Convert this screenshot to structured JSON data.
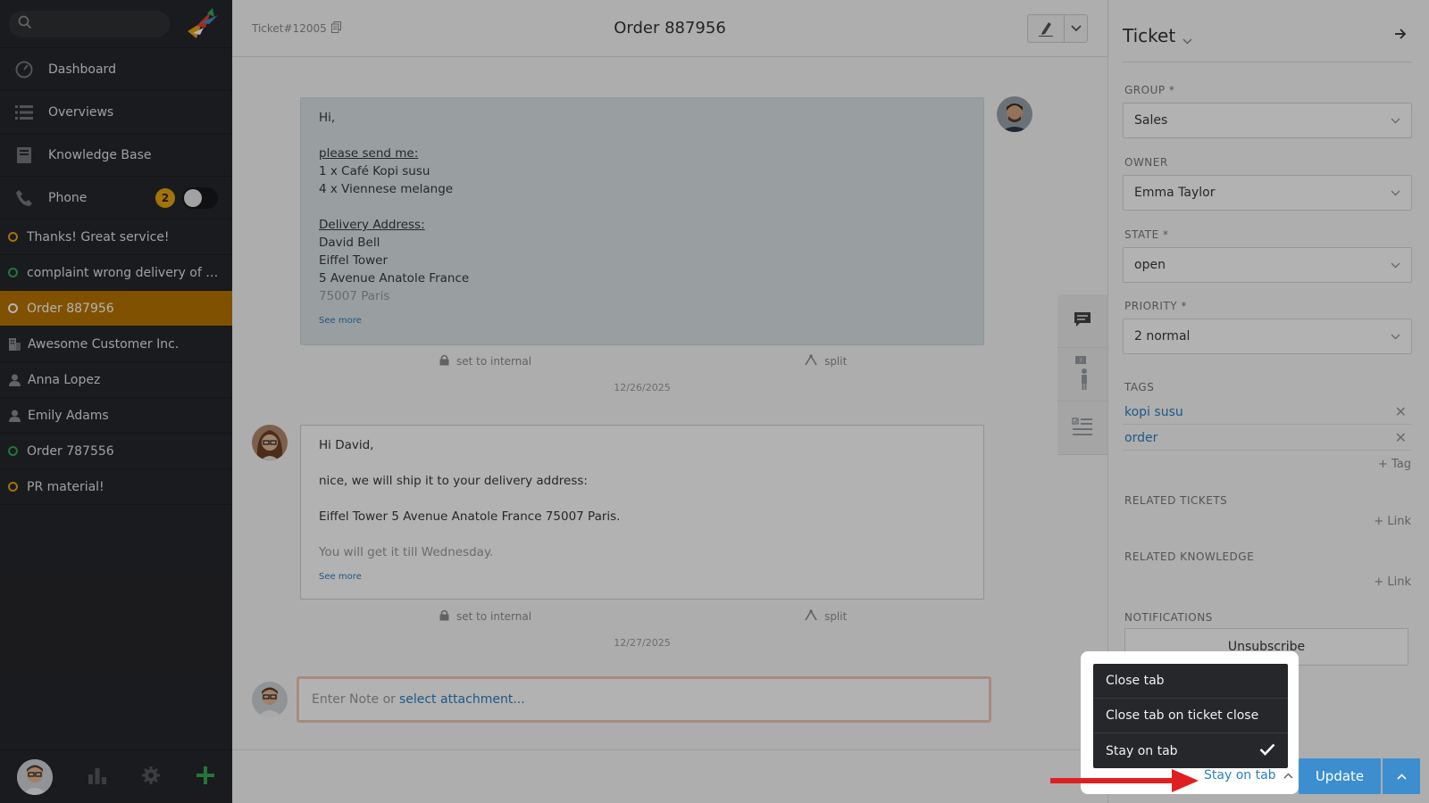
{
  "sidebar": {
    "search_placeholder": "",
    "nav": [
      {
        "label": "Dashboard",
        "icon": "dashboard-icon"
      },
      {
        "label": "Overviews",
        "icon": "list-icon"
      },
      {
        "label": "Knowledge Base",
        "icon": "book-icon"
      },
      {
        "label": "Phone",
        "icon": "phone-icon",
        "badge": "2"
      }
    ],
    "tasks": [
      {
        "label": "Thanks! Great service!",
        "kind": "ticket",
        "status": "pending"
      },
      {
        "label": "complaint wrong delivery of ord…",
        "kind": "ticket",
        "status": "open"
      },
      {
        "label": "Order 887956",
        "kind": "ticket",
        "status": "active"
      },
      {
        "label": "Awesome Customer Inc.",
        "kind": "organization"
      },
      {
        "label": "Anna Lopez",
        "kind": "user"
      },
      {
        "label": "Emily Adams",
        "kind": "user"
      },
      {
        "label": "Order 787556",
        "kind": "ticket",
        "status": "open"
      },
      {
        "label": "PR material!",
        "kind": "ticket",
        "status": "pending"
      }
    ]
  },
  "header": {
    "ticket_number": "Ticket#12005",
    "title": "Order 887956"
  },
  "articles": {
    "customer": {
      "greeting": "Hi,",
      "request_heading": "please send me:",
      "items": [
        "1 x Café Kopi susu",
        "4 x Viennese melange"
      ],
      "address_heading": "Delivery Address:",
      "address": [
        "David Bell",
        "Eiffel Tower",
        "5 Avenue Anatole France"
      ],
      "address_fade": "75007 Paris",
      "see_more": "See more",
      "set_internal": "set to internal",
      "split": "split",
      "date": "12/26/2025"
    },
    "agent": {
      "greeting": "Hi David,",
      "line1": "nice, we will ship it to your delivery address:",
      "line2": "Eiffel Tower 5 Avenue Anatole France 75007 Paris.",
      "line3": "You will get it till Wednesday.",
      "see_more": "See more",
      "set_internal": "set to internal",
      "split": "split",
      "date": "12/27/2025"
    }
  },
  "note": {
    "placeholder": "Enter Note or",
    "attachment_link": "select attachment..."
  },
  "panel": {
    "title": "Ticket",
    "group_label": "GROUP *",
    "group_value": "Sales",
    "owner_label": "OWNER",
    "owner_value": "Emma Taylor",
    "state_label": "STATE *",
    "state_value": "open",
    "priority_label": "PRIORITY *",
    "priority_value": "2 normal",
    "tags_label": "TAGS",
    "tags": [
      "kopi susu",
      "order"
    ],
    "add_tag": "+ Tag",
    "related_tickets_label": "RELATED TICKETS",
    "related_knowledge_label": "RELATED KNOWLEDGE",
    "add_link": "+ Link",
    "notifications_label": "NOTIFICATIONS",
    "unsubscribe": "Unsubscribe"
  },
  "footer_menu": {
    "options": [
      "Close tab",
      "Close tab on ticket close",
      "Stay on tab"
    ],
    "selected": "Stay on tab",
    "current_label": "Stay on tab",
    "update_button": "Update"
  },
  "colors": {
    "sidebar_bg": "#26272b",
    "active_task": "#b87400",
    "accent_blue": "#2a7fc1",
    "badge": "#e8a410",
    "annotation_arrow": "#e02020"
  }
}
